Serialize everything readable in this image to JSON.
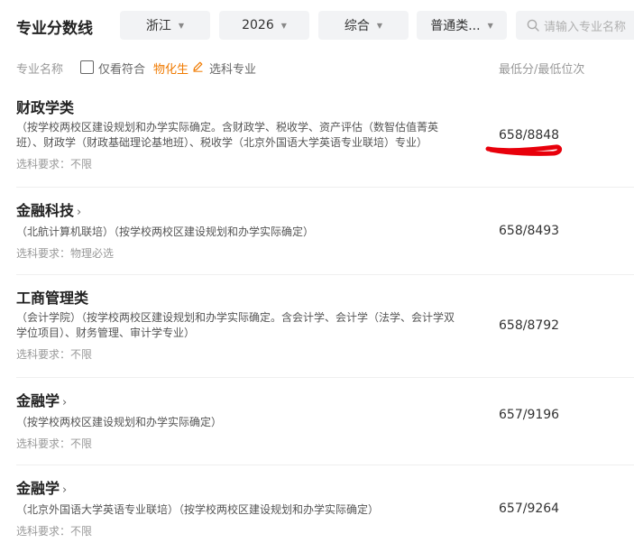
{
  "header": {
    "title": "专业分数线",
    "filters": [
      {
        "value": "浙江"
      },
      {
        "value": "2026"
      },
      {
        "value": "综合"
      },
      {
        "value": "普通类..."
      }
    ],
    "search_placeholder": "请输入专业名称"
  },
  "columns": {
    "major": "专业名称",
    "only_match_label": "仅看符合",
    "subject_combo": "物化生",
    "subject_suffix": "选科专业",
    "score": "最低分/最低位次"
  },
  "majors": [
    {
      "name": "财政学类",
      "has_arrow": false,
      "desc": "（按学校两校区建设规划和办学实际确定。含财政学、税收学、资产评估（数智估值菁英班）、财政学（财政基础理论基地班）、税收学（北京外国语大学英语专业联培）专业）",
      "req": "选科要求：不限",
      "score": "658/8848"
    },
    {
      "name": "金融科技",
      "has_arrow": true,
      "desc": "（北航计算机联培）（按学校两校区建设规划和办学实际确定）",
      "req": "选科要求：物理必选",
      "score": "658/8493"
    },
    {
      "name": "工商管理类",
      "has_arrow": false,
      "desc": "（会计学院）（按学校两校区建设规划和办学实际确定。含会计学、会计学（法学、会计学双学位项目）、财务管理、审计学专业）",
      "req": "选科要求：不限",
      "score": "658/8792"
    },
    {
      "name": "金融学",
      "has_arrow": true,
      "desc": "（按学校两校区建设规划和办学实际确定）",
      "req": "选科要求：不限",
      "score": "657/9196"
    },
    {
      "name": "金融学",
      "has_arrow": true,
      "desc": "（北京外国语大学英语专业联培）（按学校两校区建设规划和办学实际确定）",
      "req": "选科要求：不限",
      "score": "657/9264"
    }
  ],
  "colors": {
    "accent": "#f07a00",
    "annotation": "#e8000b"
  },
  "icons": {
    "dropdown": "caret-down-icon",
    "search": "search-icon",
    "edit": "pencil-icon",
    "row_arrow": "chevron-right-icon"
  }
}
